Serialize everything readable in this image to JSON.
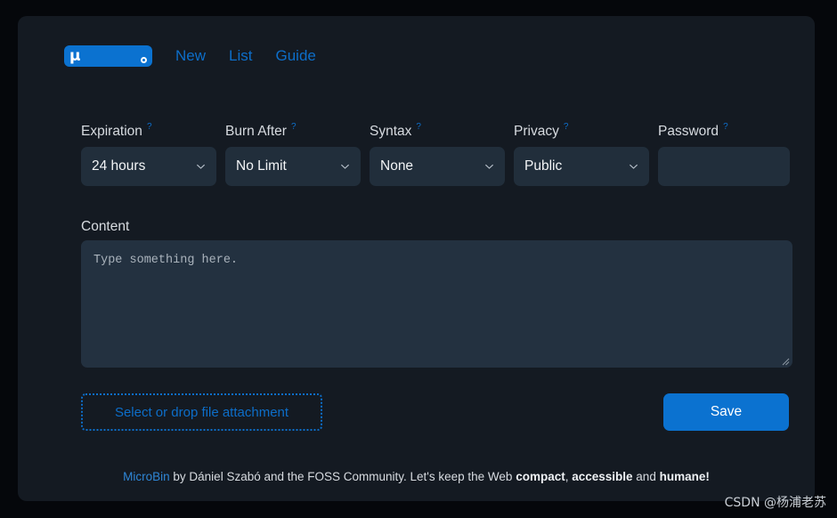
{
  "nav": {
    "logo": {
      "glyph": "μ",
      "name": "microbin-logo",
      "dot_icon": "dot-icon"
    },
    "links": [
      {
        "label": "New",
        "name": "nav-link-new"
      },
      {
        "label": "List",
        "name": "nav-link-list"
      },
      {
        "label": "Guide",
        "name": "nav-link-guide"
      }
    ]
  },
  "form": {
    "help_marker": "?",
    "fields": [
      {
        "label": "Expiration",
        "value": "24 hours",
        "type": "select"
      },
      {
        "label": "Burn After",
        "value": "No Limit",
        "type": "select"
      },
      {
        "label": "Syntax",
        "value": "None",
        "type": "select"
      },
      {
        "label": "Privacy",
        "value": "Public",
        "type": "select"
      },
      {
        "label": "Password",
        "value": "",
        "placeholder": "",
        "type": "password"
      }
    ],
    "content": {
      "label": "Content",
      "value": "",
      "placeholder": "Type something here."
    },
    "dropzone_label": "Select or drop file attachment",
    "save_label": "Save"
  },
  "footer": {
    "link_label": "MicroBin",
    "text_1": " by Dániel Szabó and the FOSS Community. Let's keep the Web ",
    "bold_1": "compact",
    "text_2": ", ",
    "bold_2": "accessible",
    "text_3": " and ",
    "bold_3": "humane!"
  },
  "watermark": {
    "text": "CSDN @杨浦老苏"
  },
  "colors": {
    "page_bg": "#05070b",
    "card_bg": "#141a22",
    "accent_blue": "#0b72d0",
    "link_blue": "#0d6ec9",
    "input_bg": "#212e3b",
    "textarea_bg": "#233140",
    "label_text": "#d7dbe0"
  }
}
